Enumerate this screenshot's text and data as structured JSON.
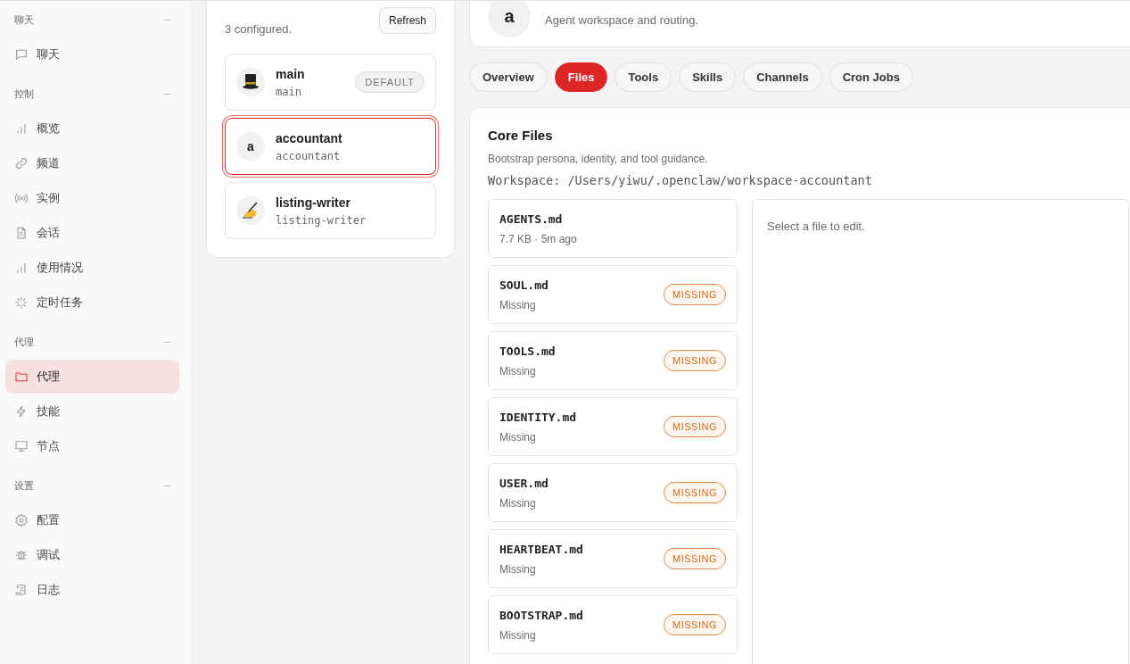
{
  "sidebar": {
    "sections": [
      {
        "title": "聊天",
        "items": [
          {
            "label": "聊天",
            "selected": false
          }
        ]
      },
      {
        "title": "控制",
        "items": [
          {
            "label": "概览",
            "selected": false
          },
          {
            "label": "频道",
            "selected": false
          },
          {
            "label": "实例",
            "selected": false
          },
          {
            "label": "会话",
            "selected": false
          },
          {
            "label": "使用情况",
            "selected": false
          },
          {
            "label": "定时任务",
            "selected": false
          }
        ]
      },
      {
        "title": "代理",
        "items": [
          {
            "label": "代理",
            "selected": true
          },
          {
            "label": "技能",
            "selected": false
          },
          {
            "label": "节点",
            "selected": false
          }
        ]
      },
      {
        "title": "设置",
        "items": [
          {
            "label": "配置",
            "selected": false
          },
          {
            "label": "调试",
            "selected": false
          },
          {
            "label": "日志",
            "selected": false
          }
        ]
      }
    ]
  },
  "agents_panel": {
    "subtitle": "3 configured.",
    "refresh_button": "Refresh",
    "agents": [
      {
        "name": "main",
        "id": "main",
        "avatar": {
          "kind": "hat"
        },
        "badge": "DEFAULT",
        "selected": false
      },
      {
        "name": "accountant",
        "id": "accountant",
        "avatar": {
          "kind": "letter",
          "text": "a"
        },
        "selected": true
      },
      {
        "name": "listing-writer",
        "id": "listing-writer",
        "avatar": {
          "kind": "hand"
        },
        "selected": false
      }
    ]
  },
  "agent_header": {
    "avatar": "a",
    "subtitle": "Agent workspace and routing."
  },
  "tabs": [
    {
      "label": "Overview",
      "selected": false
    },
    {
      "label": "Files",
      "selected": true
    },
    {
      "label": "Tools",
      "selected": false
    },
    {
      "label": "Skills",
      "selected": false
    },
    {
      "label": "Channels",
      "selected": false
    },
    {
      "label": "Cron Jobs",
      "selected": false
    }
  ],
  "core_files": {
    "title": "Core Files",
    "subtitle": "Bootstrap persona, identity, and tool guidance.",
    "workspace": "Workspace: /Users/yiwu/.openclaw/workspace-accountant",
    "files": [
      {
        "name": "AGENTS.md",
        "meta": "7.7 KB · 5m ago"
      },
      {
        "name": "SOUL.md",
        "meta": "Missing",
        "badge": "MISSING"
      },
      {
        "name": "TOOLS.md",
        "meta": "Missing",
        "badge": "MISSING"
      },
      {
        "name": "IDENTITY.md",
        "meta": "Missing",
        "badge": "MISSING"
      },
      {
        "name": "USER.md",
        "meta": "Missing",
        "badge": "MISSING"
      },
      {
        "name": "HEARTBEAT.md",
        "meta": "Missing",
        "badge": "MISSING"
      },
      {
        "name": "BOOTSTRAP.md",
        "meta": "Missing",
        "badge": "MISSING"
      }
    ],
    "editor_hint": "Select a file to edit."
  }
}
